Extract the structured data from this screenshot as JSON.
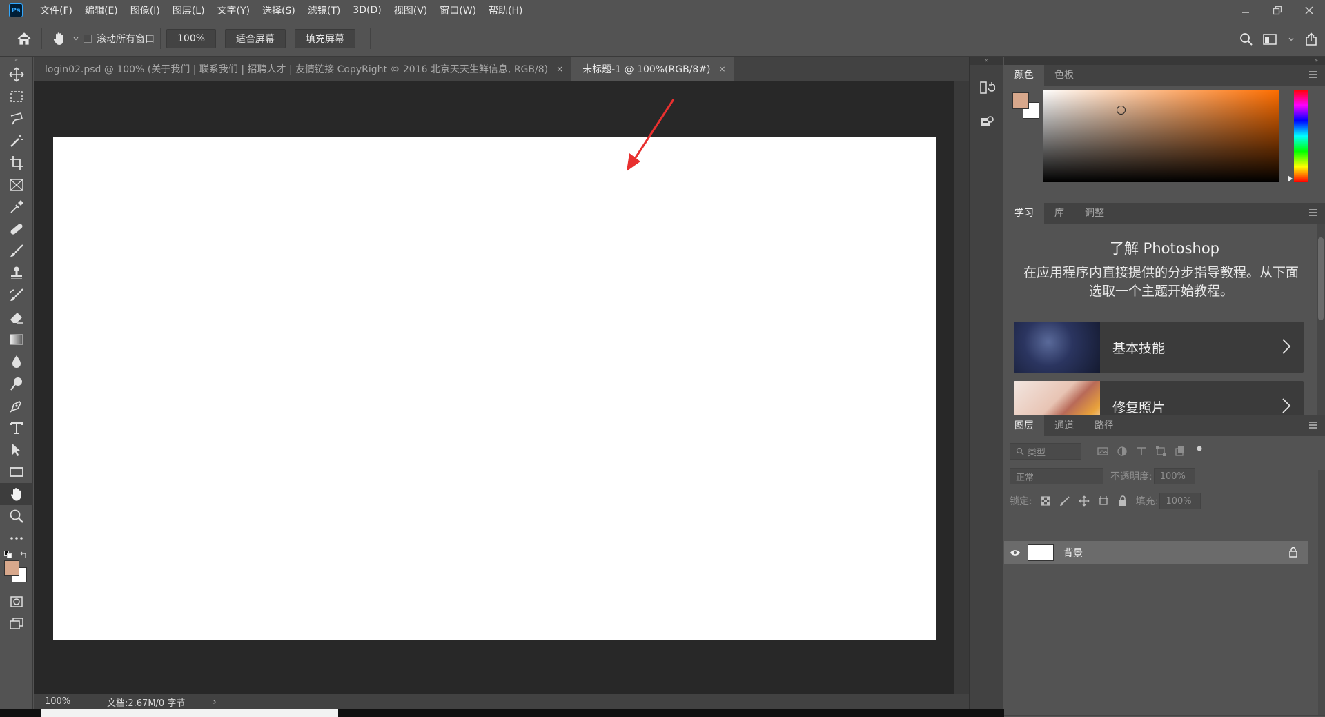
{
  "app": {
    "logo": "Ps"
  },
  "menu": [
    {
      "label": "文件(F)"
    },
    {
      "label": "编辑(E)"
    },
    {
      "label": "图像(I)"
    },
    {
      "label": "图层(L)"
    },
    {
      "label": "文字(Y)"
    },
    {
      "label": "选择(S)"
    },
    {
      "label": "滤镜(T)"
    },
    {
      "label": "3D(D)"
    },
    {
      "label": "视图(V)"
    },
    {
      "label": "窗口(W)"
    },
    {
      "label": "帮助(H)"
    }
  ],
  "options": {
    "scroll_all_label": "滚动所有窗口",
    "zoom_btn": "100%",
    "fit_screen_btn": "适合屏幕",
    "fill_screen_btn": "填充屏幕"
  },
  "tabs": [
    {
      "label": "login02.psd @ 100% (关于我们   |   联系我们   |   招聘人才   |   友情链接 CopyRight © 2016 北京天天生鲜信息, RGB/8)",
      "active": false,
      "close": "×"
    },
    {
      "label": "未标题-1 @ 100%(RGB/8#)",
      "active": true,
      "close": "×"
    }
  ],
  "status": {
    "zoom": "100%",
    "doc_info": "文档:2.67M/0 字节",
    "arrow": "›"
  },
  "colors": {
    "foreground": "#d8a88c",
    "background": "#ffffff",
    "accent": "#ff6e00"
  },
  "color_panel": {
    "tabs": [
      "颜色",
      "色板"
    ]
  },
  "learn_panel": {
    "tabs": [
      "学习",
      "库",
      "调整"
    ],
    "title": "了解 Photoshop",
    "description": "在应用程序内直接提供的分步指导教程。从下面选取一个主题开始教程。",
    "cards": [
      {
        "label": "基本技能"
      },
      {
        "label": "修复照片"
      }
    ]
  },
  "layers_panel": {
    "tabs": [
      "图层",
      "通道",
      "路径"
    ],
    "filter_placeholder": "类型",
    "blend_mode": "正常",
    "opacity_label": "不透明度:",
    "opacity_value": "100%",
    "lock_label": "锁定:",
    "fill_label": "填充:",
    "fill_value": "100%",
    "layers": [
      {
        "name": "背景",
        "visible": true,
        "locked": true
      }
    ]
  }
}
